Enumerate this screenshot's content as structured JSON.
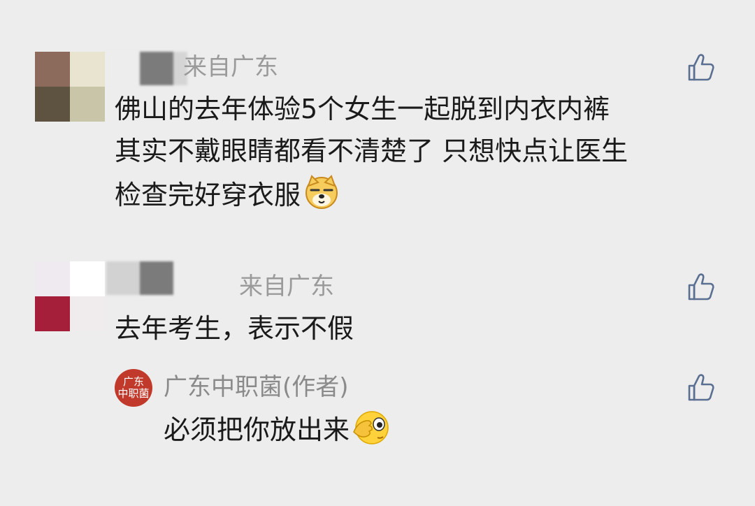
{
  "comments": [
    {
      "location": "来自广东",
      "lines": [
        "佛山的去年体验5个女生一起脱到内衣内裤",
        "其实不戴眼睛都看不清楚了 只想快点让医生",
        "检查完好穿衣服"
      ],
      "emoji": "doge-emoji"
    },
    {
      "location": "来自广东",
      "lines": [
        "去年考生，表示不假"
      ]
    }
  ],
  "reply": {
    "avatar_line1": "广东",
    "avatar_line2": "中职菌",
    "author": "广东中职菌(作者)",
    "text": "必须把你放出来",
    "emoji": "peek-face-emoji"
  },
  "icons": {
    "like": "thumbs-up-icon"
  },
  "colors": {
    "background": "#ededed",
    "text": "#1a1a1a",
    "secondary": "#9a9a9a",
    "like_icon": "#5a6f91",
    "author_avatar": "#c0392b"
  }
}
